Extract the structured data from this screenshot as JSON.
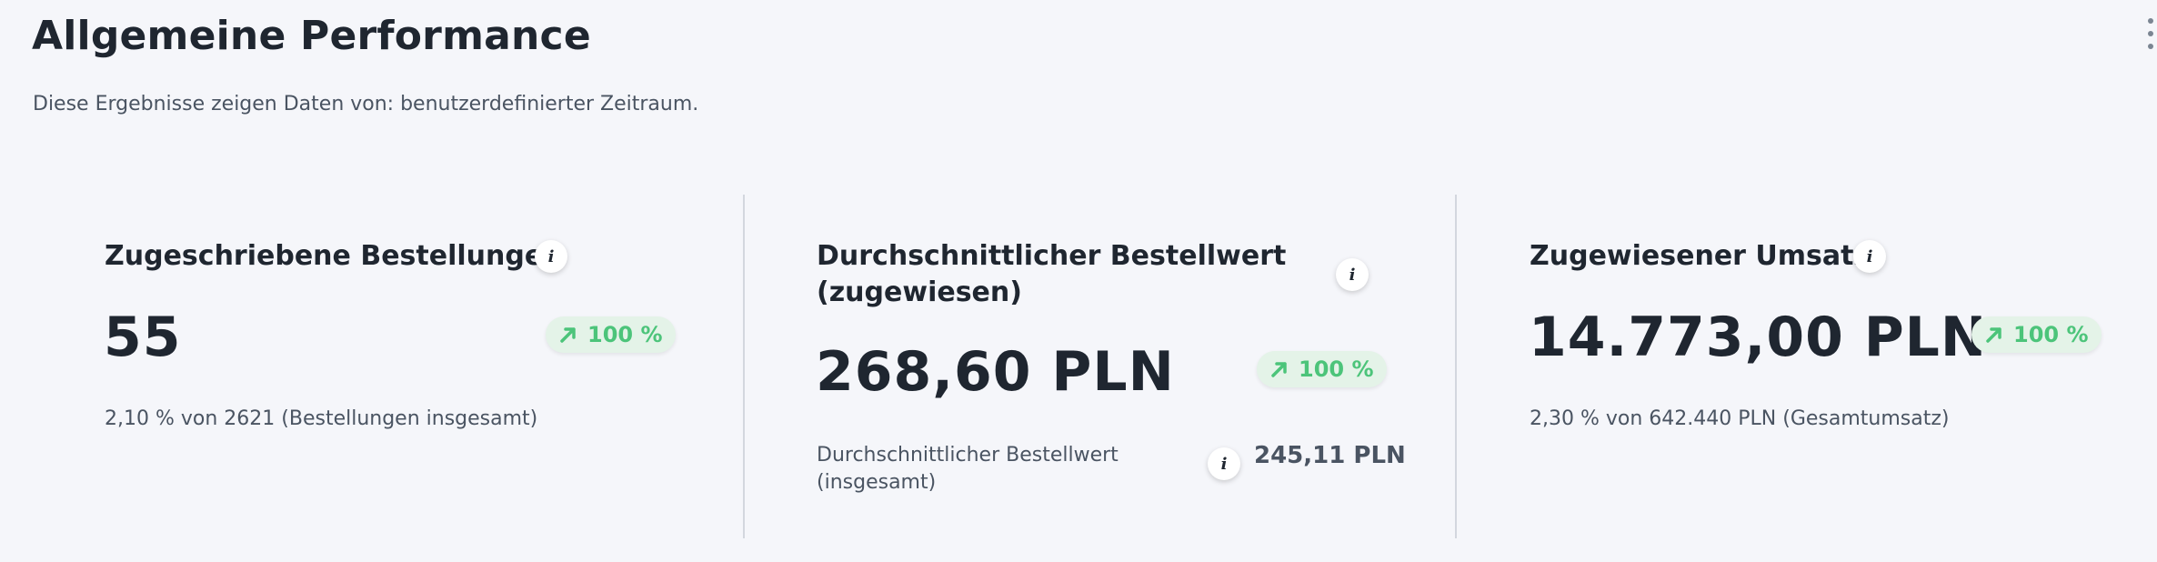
{
  "header": {
    "title": "Allgemeine Performance",
    "subtitle": "Diese Ergebnisse zeigen Daten von: benutzerdefinierter Zeitraum."
  },
  "icons": {
    "menu": "kebab-menu-icon",
    "info": "info-icon",
    "trend": "arrow-up-right-icon"
  },
  "colors": {
    "background": "#f5f6fa",
    "positive": "#4cc47a",
    "positive_bg": "#e4f3e8",
    "divider": "#d3d7de"
  },
  "cards": [
    {
      "title": "Zugeschriebene Bestellungen",
      "value": "55",
      "change": "100 %",
      "note": "2,10 % von 2621 (Bestellungen insgesamt)"
    },
    {
      "title": "Durchschnittlicher Bestellwert (zugewiesen)",
      "value": "268,60 PLN",
      "change": "100 %",
      "secondary_label": "Durchschnittlicher Bestellwert (insgesamt)",
      "secondary_value": "245,11 PLN"
    },
    {
      "title": "Zugewiesener Umsatz",
      "value": "14.773,00 PLN",
      "change": "100 %",
      "note": "2,30 % von 642.440 PLN (Gesamtumsatz)"
    }
  ]
}
